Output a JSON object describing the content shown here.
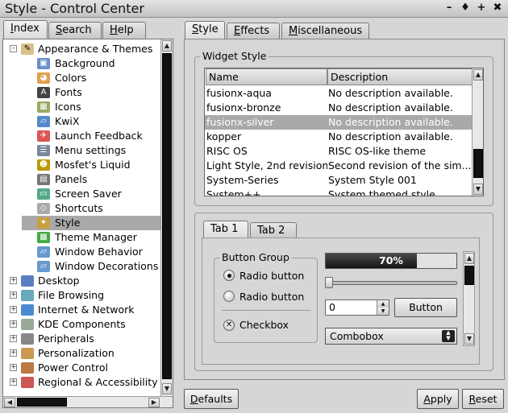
{
  "window": {
    "title": "Style - Control Center",
    "buttons": [
      "–",
      "♦",
      "+",
      "✖"
    ]
  },
  "left_tabs": [
    {
      "label": "Index",
      "mnemonic": "I",
      "rest": "ndex",
      "active": true
    },
    {
      "label": "Search",
      "mnemonic": "S",
      "rest": "earch",
      "active": false
    },
    {
      "label": "Help",
      "mnemonic": "H",
      "rest": "elp",
      "active": false
    }
  ],
  "tree": {
    "root": "Appearance & Themes",
    "children": [
      {
        "label": "Background",
        "icon": "background-icon"
      },
      {
        "label": "Colors",
        "icon": "colors-icon"
      },
      {
        "label": "Fonts",
        "icon": "fonts-icon"
      },
      {
        "label": "Icons",
        "icon": "icons-icon"
      },
      {
        "label": "KwiX",
        "icon": "kwix-icon"
      },
      {
        "label": "Launch Feedback",
        "icon": "launch-feedback-icon"
      },
      {
        "label": "Menu settings",
        "icon": "menu-settings-icon"
      },
      {
        "label": "Mosfet's Liquid",
        "icon": "liquid-icon"
      },
      {
        "label": "Panels",
        "icon": "panels-icon"
      },
      {
        "label": "Screen Saver",
        "icon": "screensaver-icon"
      },
      {
        "label": "Shortcuts",
        "icon": "shortcuts-icon"
      },
      {
        "label": "Style",
        "icon": "style-icon",
        "selected": true
      },
      {
        "label": "Theme Manager",
        "icon": "theme-manager-icon"
      },
      {
        "label": "Window Behavior",
        "icon": "window-behavior-icon"
      },
      {
        "label": "Window Decorations",
        "icon": "window-decorations-icon"
      }
    ],
    "categories": [
      "Desktop",
      "File Browsing",
      "Internet & Network",
      "KDE Components",
      "Peripherals",
      "Personalization",
      "Power Control",
      "Regional & Accessibility"
    ],
    "expand_symbol": "+",
    "collapse_symbol": "–"
  },
  "right_tabs": [
    {
      "label": "Style",
      "mnemonic": "S",
      "rest": "tyle",
      "active": true
    },
    {
      "label": "Effects",
      "mnemonic": "E",
      "rest": "ffects",
      "active": false
    },
    {
      "label": "Miscellaneous",
      "mnemonic": "M",
      "rest": "iscellaneous",
      "active": false
    }
  ],
  "widget_style": {
    "group_title": "Widget Style",
    "columns": [
      "Name",
      "Description"
    ],
    "rows": [
      {
        "name": "fusionx-aqua",
        "desc": "No description available."
      },
      {
        "name": "fusionx-bronze",
        "desc": "No description available."
      },
      {
        "name": "fusionx-silver",
        "desc": "No description available.",
        "selected": true
      },
      {
        "name": "kopper",
        "desc": "No description available."
      },
      {
        "name": "RISC OS",
        "desc": "RISC OS-like theme"
      },
      {
        "name": "Light Style, 2nd revision",
        "desc": "Second revision of the sim..."
      },
      {
        "name": "System-Series",
        "desc": "System Style 001"
      },
      {
        "name": "System++",
        "desc": "System themed style"
      }
    ]
  },
  "preview": {
    "tabs": [
      "Tab 1",
      "Tab 2"
    ],
    "button_group": {
      "title": "Button Group",
      "radio1": "Radio button",
      "radio2": "Radio button",
      "checkbox": "Checkbox"
    },
    "progress": {
      "value": 0.7,
      "label": "70%"
    },
    "slider": {
      "value": 0
    },
    "spinbox": {
      "value": "0"
    },
    "button_label": "Button",
    "combobox": "Combobox"
  },
  "bottom_buttons": {
    "defaults": "Defaults",
    "defaults_mn": "D",
    "defaults_rest": "efaults",
    "apply": "Apply",
    "apply_mn": "A",
    "apply_rest": "pply",
    "reset": "Reset",
    "reset_mn": "R",
    "reset_rest": "eset"
  },
  "colors": {
    "selection": "#a9a9a9",
    "progress_fill": "#1a1a1a",
    "window_bg": "#d6d6d6"
  }
}
